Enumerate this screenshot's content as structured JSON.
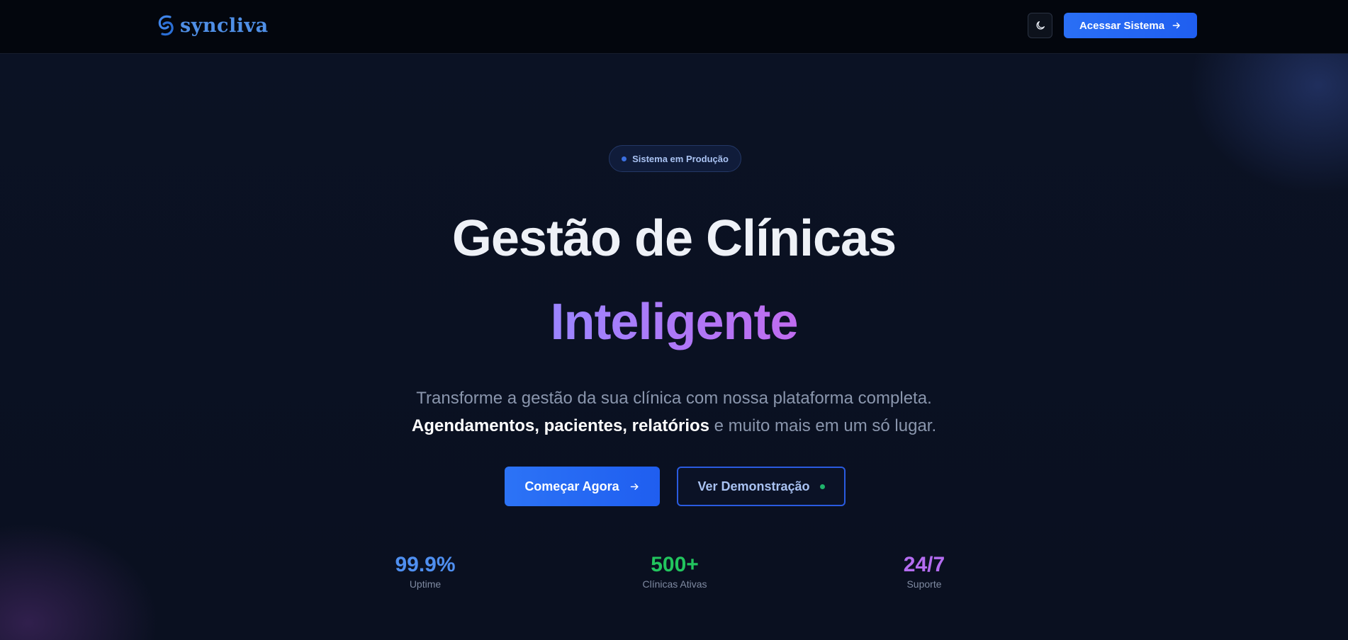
{
  "header": {
    "brand": "syncliva",
    "theme_toggle_icon": "moon-icon",
    "access_button": "Acessar Sistema"
  },
  "hero": {
    "badge": "Sistema em Produção",
    "title_line1": "Gestão de Clínicas",
    "title_line2": "Inteligente",
    "subtitle_line1": "Transforme a gestão da sua clínica com nossa plataforma completa.",
    "subtitle_highlight": "Agendamentos, pacientes, relatórios",
    "subtitle_rest": " e muito mais em um só lugar.",
    "primary_cta": "Começar Agora",
    "secondary_cta": "Ver Demonstração"
  },
  "stats": [
    {
      "value": "99.9%",
      "label": "Uptime",
      "color": "#4f8ff0"
    },
    {
      "value": "500+",
      "label": "Clínicas Ativas",
      "color": "#22c55e"
    },
    {
      "value": "24/7",
      "label": "Suporte",
      "color": "#b46cf0"
    }
  ],
  "colors": {
    "accent": "#1f5ef0",
    "background": "#0a1020",
    "header": "#03060d"
  }
}
